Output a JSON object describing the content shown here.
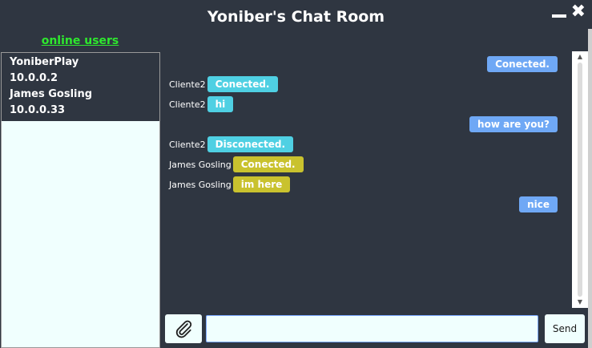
{
  "window": {
    "title": "Yoniber's Chat Room"
  },
  "sidebar": {
    "label": "online users",
    "users": [
      {
        "name": "YoniberPlay",
        "ip": "10.0.0.2"
      },
      {
        "name": "James Gosling",
        "ip": "10.0.0.33"
      }
    ]
  },
  "messages": [
    {
      "sender": "",
      "text": "Conected.",
      "side": "right",
      "color": "#6fa8f5"
    },
    {
      "sender": "Cliente2",
      "text": "Conected.",
      "side": "left",
      "color": "#4fd0e3"
    },
    {
      "sender": "Cliente2",
      "text": "hi",
      "side": "left",
      "color": "#4fd0e3"
    },
    {
      "sender": "",
      "text": "how are you?",
      "side": "right",
      "color": "#6fa8f5"
    },
    {
      "sender": "Cliente2",
      "text": "Disconected.",
      "side": "left",
      "color": "#4fd0e3"
    },
    {
      "sender": "James Gosling",
      "text": "Conected.",
      "side": "left",
      "color": "#c9c22e"
    },
    {
      "sender": "James Gosling",
      "text": "im here",
      "side": "left",
      "color": "#c9c22e"
    },
    {
      "sender": "",
      "text": "nice",
      "side": "right",
      "color": "#6fa8f5"
    }
  ],
  "composer": {
    "input_value": "",
    "send_label": "Send"
  },
  "icons": {
    "attach": "paperclip-icon",
    "minimize": "minimize-icon",
    "close": "close-icon"
  }
}
